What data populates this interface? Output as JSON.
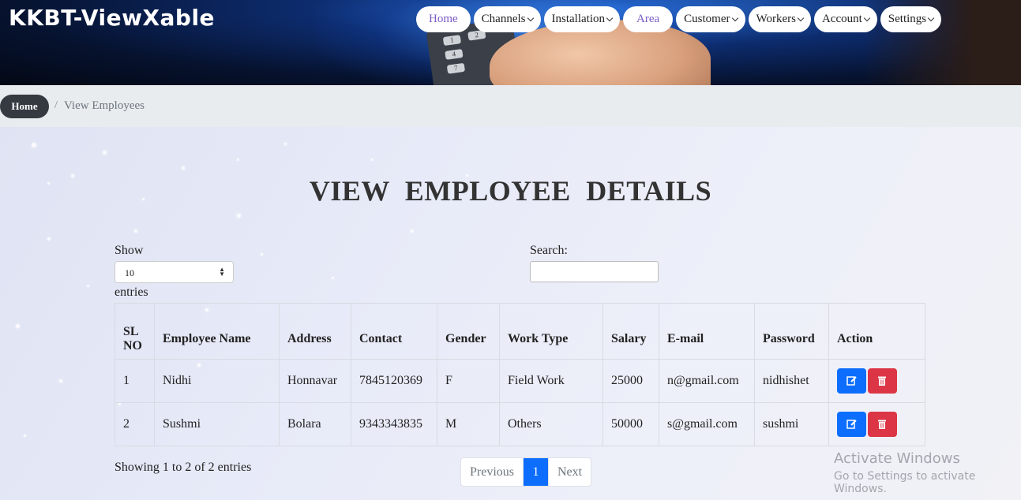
{
  "header": {
    "brand": "KKBT-ViewXable",
    "remote_keys": [
      "1",
      "2",
      "4",
      "7"
    ]
  },
  "nav": [
    {
      "label": "Home",
      "dropdown": false,
      "highlight": true
    },
    {
      "label": "Channels",
      "dropdown": true,
      "highlight": false
    },
    {
      "label": "Installation",
      "dropdown": true,
      "highlight": false
    },
    {
      "label": "Area",
      "dropdown": false,
      "highlight": true
    },
    {
      "label": "Customer",
      "dropdown": true,
      "highlight": false
    },
    {
      "label": "Workers",
      "dropdown": true,
      "highlight": false
    },
    {
      "label": "Account",
      "dropdown": true,
      "highlight": false
    },
    {
      "label": "Settings",
      "dropdown": true,
      "highlight": false
    }
  ],
  "breadcrumb": {
    "home": "Home",
    "separator": "/",
    "current": "View Employees"
  },
  "page": {
    "title": "VIEW EMPLOYEE DETAILS"
  },
  "controls": {
    "show_label": "Show",
    "show_value": "10",
    "entries_label": "entries",
    "search_label": "Search:",
    "search_value": ""
  },
  "table": {
    "headers": [
      "SL NO",
      "Employee Name",
      "Address",
      "Contact",
      "Gender",
      "Work Type",
      "Salary",
      "E-mail",
      "Password",
      "Action"
    ],
    "rows": [
      {
        "sl": "1",
        "name": "Nidhi",
        "address": "Honnavar",
        "contact": "7845120369",
        "gender": "F",
        "work_type": "Field Work",
        "salary": "25000",
        "email": "n@gmail.com",
        "password": "nidhishet"
      },
      {
        "sl": "2",
        "name": "Sushmi",
        "address": "Bolara",
        "contact": "9343343835",
        "gender": "M",
        "work_type": "Others",
        "salary": "50000",
        "email": "s@gmail.com",
        "password": "sushmi"
      }
    ]
  },
  "footer": {
    "info": "Showing 1 to 2 of 2 entries",
    "prev": "Previous",
    "current_page": "1",
    "next": "Next"
  },
  "watermark": {
    "line1": "Activate Windows",
    "line2": "Go to Settings to activate Windows."
  },
  "colors": {
    "primary": "#0d6efd",
    "danger": "#dc3545",
    "nav_highlight": "#7b5bc7",
    "breadcrumb_home": "#343a40"
  },
  "icons": {
    "edit": "edit-icon",
    "delete": "trash-icon",
    "dropdown": "chevron-down-icon",
    "select": "updown-icon"
  }
}
